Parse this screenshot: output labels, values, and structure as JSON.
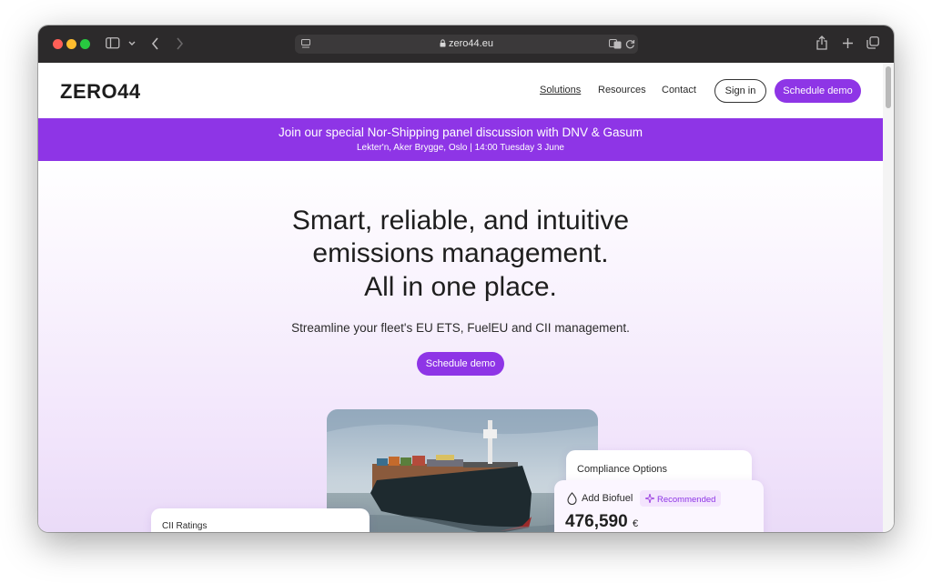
{
  "browser": {
    "url": "zero44.eu",
    "lock_icon": "lock-icon",
    "colors": {
      "titlebar": "#2c2a2b",
      "close": "#ff5f57",
      "minimize": "#febc2e",
      "zoom": "#28c840"
    }
  },
  "nav": {
    "logo": "ZERO44",
    "links": [
      "Solutions",
      "Resources",
      "Contact"
    ],
    "sign_in": "Sign in",
    "schedule_demo": "Schedule demo"
  },
  "banner": {
    "title": "Join our special Nor-Shipping panel discussion with DNV & Gasum",
    "subtitle": "Lekter'n, Aker Brygge, Oslo | 14:00 Tuesday 3 June"
  },
  "hero": {
    "title_lines": [
      "Smart, reliable, and intuitive",
      "emissions management.",
      "All in one place."
    ],
    "subtitle": "Streamline your fleet's EU ETS, FuelEU and CII management.",
    "cta": "Schedule demo"
  },
  "cards": {
    "cii": {
      "title": "CII Ratings"
    },
    "compliance": {
      "title": "Compliance Options"
    },
    "biofuel": {
      "label": "Add Biofuel",
      "badge": "Recommended",
      "value": "476,590",
      "currency": "€"
    }
  },
  "accent_color": "#8e35e6"
}
